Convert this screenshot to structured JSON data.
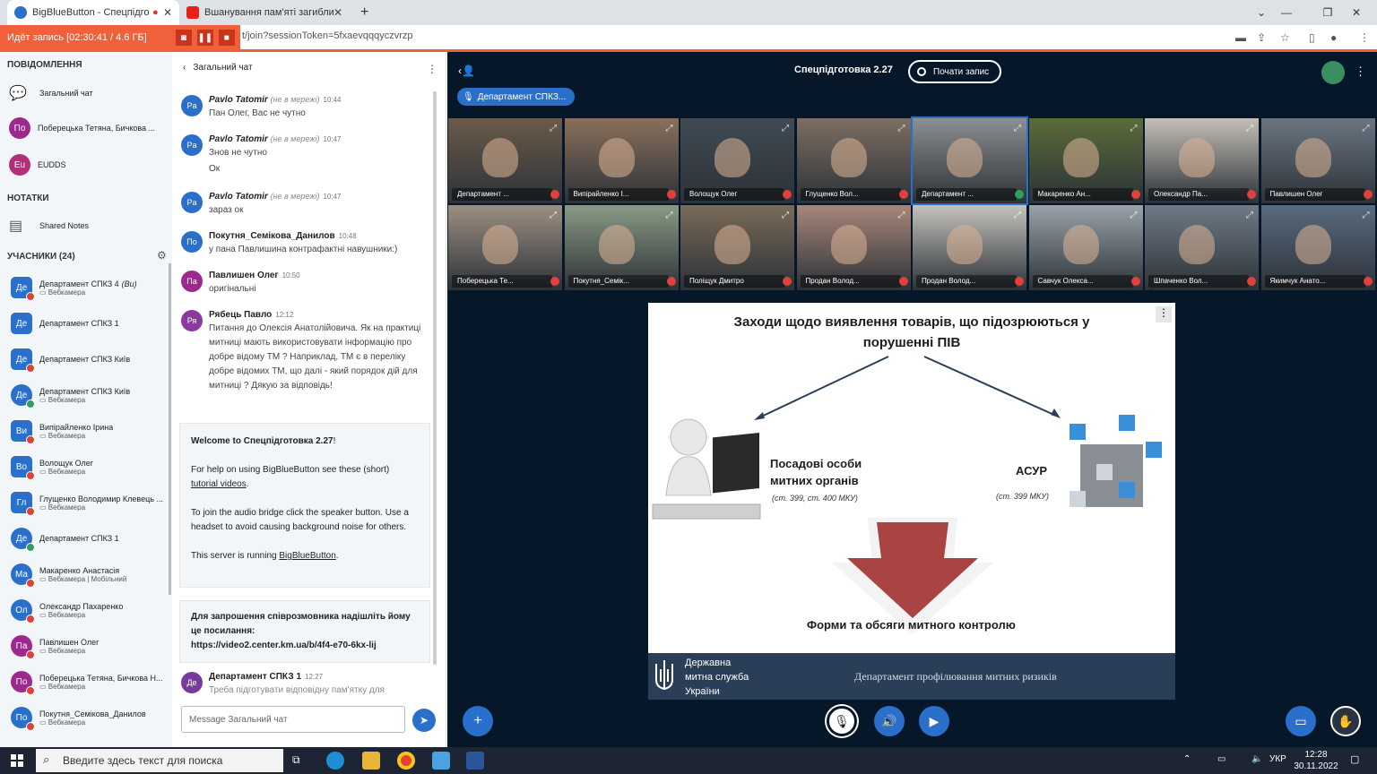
{
  "browser": {
    "tabs": [
      {
        "title": "BigBlueButton - Спецпідготов",
        "active": true
      },
      {
        "title": "Вшанування пам'яті загиблих -",
        "active": false
      }
    ],
    "url": "t/join?sessionToken=5fxaevqqqyczvrzp",
    "recording": "Идёт запись [02:30:41 / 4.6 ГБ]"
  },
  "sidebar": {
    "messages_heading": "ПОВІДОМЛЕННЯ",
    "chats": [
      {
        "avatar": "",
        "label": "Загальний чат"
      },
      {
        "avatar": "По",
        "label": "Поберецька Тетяна, Бичкова ..."
      },
      {
        "avatar": "Eu",
        "label": "EUDDS"
      }
    ],
    "notes_heading": "НОТАТКИ",
    "shared_notes": "Shared Notes",
    "users_heading": "УЧАСНИКИ (24)",
    "users": [
      {
        "avatar": "Де",
        "name": "Департамент СПКЗ 4",
        "you": "(Ви)",
        "sub": "Вебкамера",
        "mic": "muted"
      },
      {
        "avatar": "Де",
        "name": "Департамент СПКЗ 1",
        "you": "",
        "sub": "",
        "mic": "none"
      },
      {
        "avatar": "Де",
        "name": "Департамент СПКЗ Київ",
        "you": "",
        "sub": "",
        "mic": "muted"
      },
      {
        "avatar": "Де",
        "name": "Департамент СПКЗ Київ",
        "you": "",
        "sub": "Вебкамера",
        "mic": "active"
      },
      {
        "avatar": "Ви",
        "name": "Випірайленко Ірина",
        "you": "",
        "sub": "Вебкамера",
        "mic": "muted"
      },
      {
        "avatar": "Во",
        "name": "Волощук Олег",
        "you": "",
        "sub": "Вебкамера",
        "mic": "muted"
      },
      {
        "avatar": "Гл",
        "name": "Глущенко Володимир Клевець ...",
        "you": "",
        "sub": "Вебкамера",
        "mic": "muted"
      },
      {
        "avatar": "Де",
        "name": "Департамент СПКЗ 1",
        "you": "",
        "sub": "",
        "mic": "active"
      },
      {
        "avatar": "Ма",
        "name": "Макаренко Анастасія",
        "you": "",
        "sub": "Вебкамера | Мобільний",
        "mic": "muted"
      },
      {
        "avatar": "Ол",
        "name": "Олександр Пахаренко",
        "you": "",
        "sub": "Вебкамера",
        "mic": "muted"
      },
      {
        "avatar": "Па",
        "name": "Павлишен Олег",
        "you": "",
        "sub": "Вебкамера",
        "mic": "muted"
      },
      {
        "avatar": "По",
        "name": "Поберецька Тетяна, Бичкова Н...",
        "you": "",
        "sub": "Вебкамера",
        "mic": "muted"
      },
      {
        "avatar": "По",
        "name": "Покутня_Семікова_Данилов",
        "you": "",
        "sub": "Вебкамера",
        "mic": "muted"
      }
    ]
  },
  "chat": {
    "title": "Загальний чат",
    "messages": [
      {
        "avatar": "Pa",
        "name": "Pavlo Tatomir",
        "offline": "(не в мережі)",
        "time": "10:44",
        "lines": [
          "Пан Олег, Вас не чутно"
        ]
      },
      {
        "avatar": "Pa",
        "name": "Pavlo Tatomir",
        "offline": "(не в мережі)",
        "time": "10:47",
        "lines": [
          "Знов не чутно",
          "Ок"
        ]
      },
      {
        "avatar": "Pa",
        "name": "Pavlo Tatomir",
        "offline": "(не в мережі)",
        "time": "10:47",
        "lines": [
          "зараз ок"
        ]
      },
      {
        "avatar": "По",
        "name": "Покутня_Семікова_Данилов",
        "offline": "",
        "time": "10:48",
        "lines": [
          "у пана Павлишина контрафактні навушники:)"
        ]
      },
      {
        "avatar": "Па",
        "name": "Павлишен Олег",
        "offline": "",
        "time": "10:50",
        "lines": [
          "оригінальні"
        ]
      },
      {
        "avatar": "Ря",
        "name": "Рябець Павло",
        "offline": "",
        "time": "12:12",
        "lines": [
          "Питання до Олексія Анатолійовича. Як на практиці митниці мають використовувати інформацію про добре відому ТМ ? Наприклад, ТМ є в переліку добре відомих ТМ, що далі - який порядок дій для митниці ? Дякую за відповідь!"
        ]
      }
    ],
    "welcome": {
      "line1_pre": "Welcome to ",
      "line1_bold": "Спецпідготовка 2.27",
      "line1_post": "!",
      "help_pre": "For help on using BigBlueButton see these (short) ",
      "help_link": "tutorial videos",
      "help_post": ".",
      "audio": "To join the audio bridge click the speaker button. Use a headset to avoid causing background noise for others.",
      "server_pre": "This server is running ",
      "server_link": "BigBlueButton",
      "server_post": "."
    },
    "invite": {
      "text": "Для запрошення співрозмовника надішліть йому це посилання:",
      "link": "https://video2.center.km.ua/b/4f4-e70-6kx-lij"
    },
    "last": {
      "avatar": "Де",
      "name": "Департамент СПКЗ 1",
      "time": "12:27",
      "text": "Треба підготувати відповідну пам'ятку для"
    },
    "input_placeholder": "Message Загальний чат"
  },
  "main": {
    "title": "Спецпідготовка 2.27",
    "record_button": "Почати запис",
    "talking": "Департамент СПКЗ...",
    "tiles": [
      {
        "label": "Департамент ...",
        "mic": "muted",
        "color": "#6b5a4a"
      },
      {
        "label": "Випірайленко І...",
        "mic": "muted",
        "color": "#8a6f5c"
      },
      {
        "label": "Волощук Олег",
        "mic": "muted",
        "color": "#3f4a52"
      },
      {
        "label": "Глущенко Вол...",
        "mic": "muted",
        "color": "#7d6e63"
      },
      {
        "label": "Департамент ...",
        "mic": "active",
        "color": "#8c8f92",
        "selected": true
      },
      {
        "label": "Макаренко Ан...",
        "mic": "muted",
        "color": "#5b6b3a"
      },
      {
        "label": "Олександр Па...",
        "mic": "muted",
        "color": "#c5bfb6"
      },
      {
        "label": "Павлишен Олег",
        "mic": "muted",
        "color": "#6a7580"
      },
      {
        "label": "Поберецька Те...",
        "mic": "muted",
        "color": "#9c8f82"
      },
      {
        "label": "Покутня_Семік...",
        "mic": "muted",
        "color": "#8a9a84"
      },
      {
        "label": "Поліщук Дмитро",
        "mic": "muted",
        "color": "#7a6a58"
      },
      {
        "label": "Продан Волод...",
        "mic": "muted",
        "color": "#a8867a"
      },
      {
        "label": "Продан Волод...",
        "mic": "muted",
        "color": "#c4c2bd"
      },
      {
        "label": "Савчук Олекса...",
        "mic": "muted",
        "color": "#9aa3aa"
      },
      {
        "label": "Шпаченко Вол...",
        "mic": "muted",
        "color": "#6f7a86"
      },
      {
        "label": "Якимчук Анато...",
        "mic": "muted",
        "color": "#5a6a7e"
      }
    ]
  },
  "slide": {
    "title_line1": "Заходи щодо виявлення товарів, що підозрюються у",
    "title_line2": "порушенні ПІВ",
    "left_label_1": "Посадові особи",
    "left_label_2": "митних органів",
    "left_ref": "(ст. 399, ст. 400 МКУ)",
    "right_label": "АСУР",
    "right_ref": "(ст. 399 МКУ)",
    "bottom_label": "Форми та обсяги митного контролю",
    "footer_org_1": "Державна",
    "footer_org_2": "митна служба",
    "footer_org_3": "України",
    "footer_dept": "Департамент профілювання митних ризиків"
  },
  "taskbar": {
    "search": "Введите здесь текст для поиска",
    "lang": "УКР",
    "time": "12:28",
    "date": "30.11.2022"
  }
}
